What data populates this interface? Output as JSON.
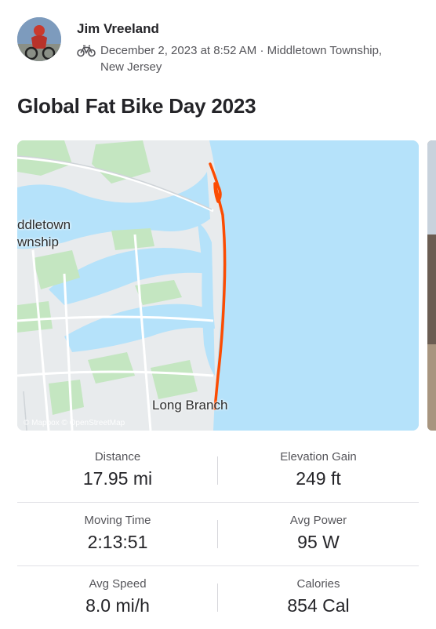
{
  "activity": {
    "athlete_name": "Jim Vreeland",
    "activity_type_icon": "bike-icon",
    "date_location_line1": "December 2, 2023 at 8:52 AM · Middletown Township,",
    "date_location_line2": "New Jersey",
    "title": "Global Fat Bike Day 2023"
  },
  "map": {
    "labels": {
      "town_line1": "ddletown",
      "town_line2": "wnship",
      "city": "Long Branch"
    },
    "attribution": "© Mapbox © OpenStreetMap",
    "route_color": "#fc4c02",
    "water_color": "#b5e2fa"
  },
  "stats": [
    {
      "label": "Distance",
      "value": "17.95 mi"
    },
    {
      "label": "Elevation Gain",
      "value": "249 ft"
    },
    {
      "label": "Moving Time",
      "value": "2:13:51"
    },
    {
      "label": "Avg Power",
      "value": "95 W"
    },
    {
      "label": "Avg Speed",
      "value": "8.0 mi/h"
    },
    {
      "label": "Calories",
      "value": "854 Cal"
    }
  ]
}
